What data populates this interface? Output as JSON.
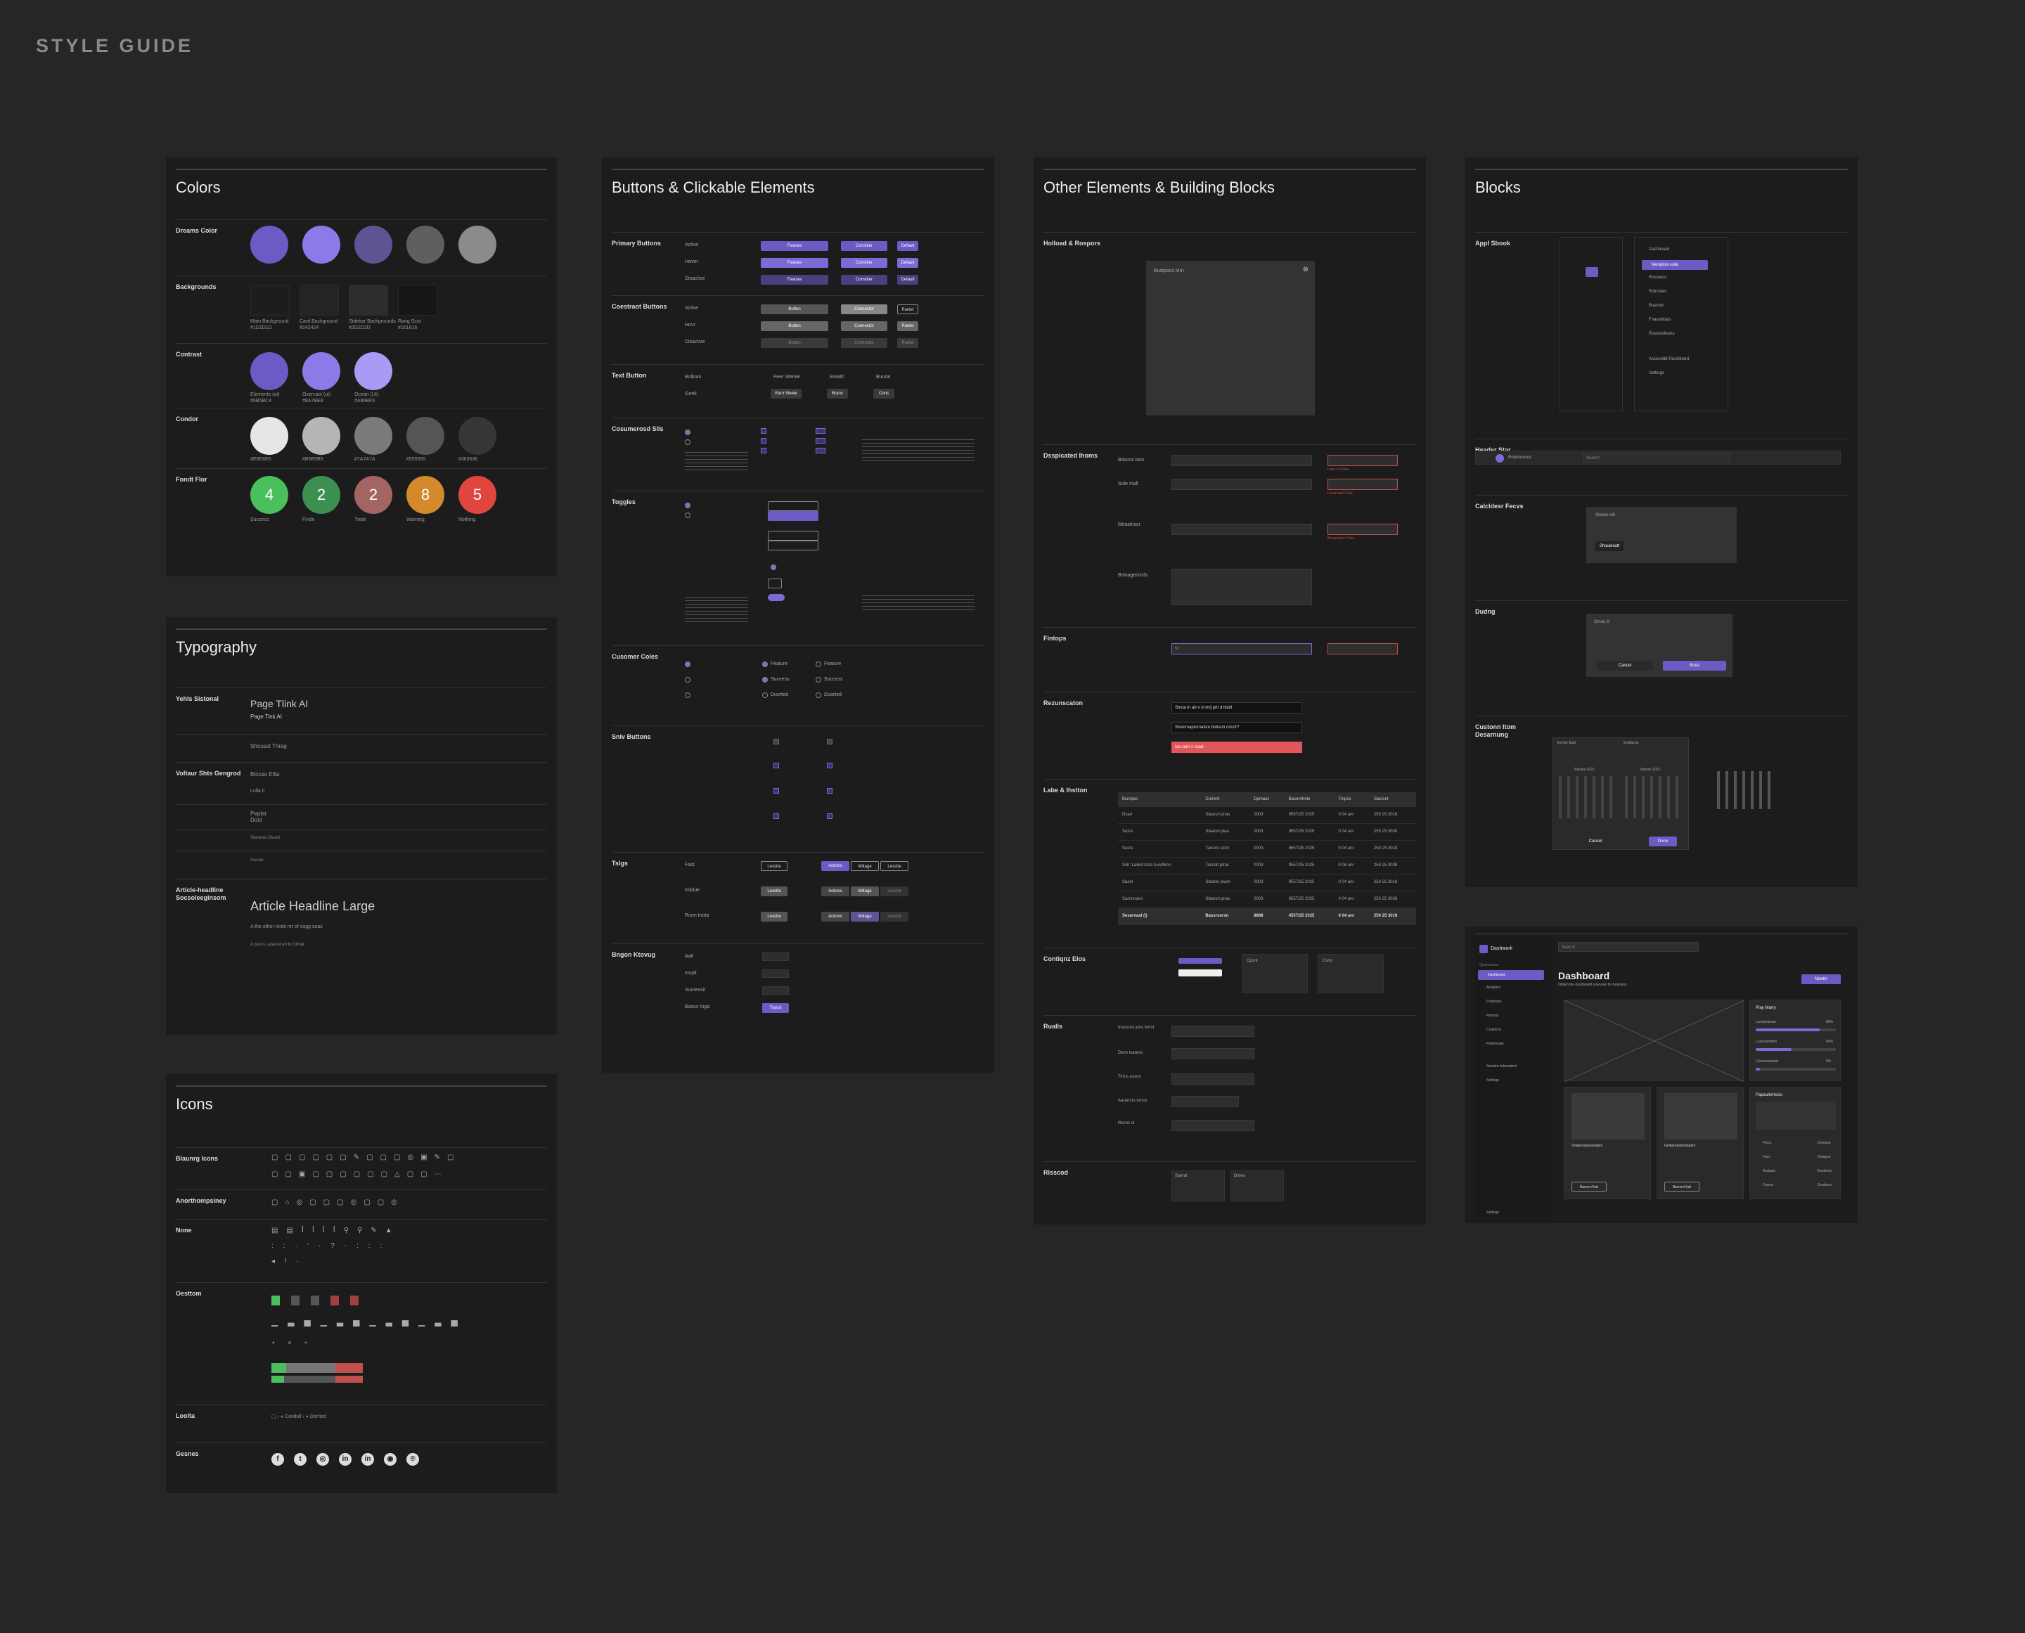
{
  "header": "STYLE GUIDE",
  "colors": {
    "title": "Colors",
    "brand": {
      "label": "Dreams Color",
      "swatches": [
        "#6b5bc4",
        "#8a7be8",
        "#5d5494",
        "#5f5f5f",
        "#8b8b8b"
      ]
    },
    "backgrounds": {
      "label": "Backgrounds",
      "swatches": [
        {
          "color": "#1d1d1d",
          "name": "Main Background",
          "hex": "#1D1D1D"
        },
        {
          "color": "#242424",
          "name": "Card Background",
          "hex": "#242424"
        },
        {
          "color": "#2d2d2d",
          "name": "Sidebar Backgrounds",
          "hex": "#2D2D2D"
        },
        {
          "color": "#161616",
          "name": "Rang Scot",
          "hex": "#161616"
        }
      ]
    },
    "accents": {
      "label": "Contrast",
      "swatches": [
        {
          "color": "#6b5bc4",
          "name": "Elements (ut)",
          "hex": "#6B5BC4"
        },
        {
          "color": "#8a7be8",
          "name": "Overcast (ut)",
          "hex": "#8A7BE8"
        },
        {
          "color": "#a99bf5",
          "name": "Ocean (Ut)",
          "hex": "#A99BF5"
        }
      ]
    },
    "greys": {
      "label": "Condor",
      "swatches": [
        {
          "color": "#e6e6e6",
          "hex": "#E6E6E6"
        },
        {
          "color": "#b5b5b5",
          "hex": "#B5B5B5"
        },
        {
          "color": "#7a7a7a",
          "hex": "#7A7A7A"
        },
        {
          "color": "#555555",
          "hex": "#555555"
        },
        {
          "color": "#363636",
          "hex": "#363636"
        }
      ]
    },
    "status": {
      "label": "Fondt Flor",
      "swatches": [
        {
          "color": "#4bbf5b",
          "num": "4",
          "name": "Success"
        },
        {
          "color": "#3c8f4f",
          "num": "2",
          "name": "Finde"
        },
        {
          "color": "#a56464",
          "num": "2",
          "name": "Treat"
        },
        {
          "color": "#d48a2a",
          "num": "8",
          "name": "Warning"
        },
        {
          "color": "#e0463e",
          "num": "5",
          "name": "Nothing"
        }
      ]
    }
  },
  "typography": {
    "title": "Typography",
    "rows": [
      {
        "label": "Yehls Sistonal",
        "big": "Page Tlink AI",
        "small": "Page Tink AI"
      },
      {
        "label": "",
        "small": "Shousst Thrag"
      },
      {
        "label": "Voltaur Shts Gengrod",
        "small": "Blocas Ellia"
      },
      {
        "label": "",
        "small": "Lolla ti"
      },
      {
        "label": "",
        "small": "Peplat Dold"
      },
      {
        "label": "",
        "small": "Stanatas Dlaaci"
      },
      {
        "label": "",
        "small": "Asenia"
      }
    ],
    "article": {
      "label": "Article-headline Socsoleeginsom",
      "big": "Article Headline Large",
      "line1": "A the other lonbt nrt of osgg seas",
      "line2": "A pssirs Lasesorsnt ln Gtrbat"
    }
  },
  "icons": {
    "title": "Icons",
    "sections": [
      {
        "label": "Blaunrg Icons"
      },
      {
        "label": "Anorthompsiney"
      },
      {
        "label": "None"
      },
      {
        "label": "Oesttom"
      },
      {
        "label": "Loolta"
      },
      {
        "label": "Gesnes"
      }
    ],
    "breadcrumb": {
      "a": "Contloll",
      "b": "Dorried"
    },
    "social": [
      "f",
      "t",
      "◎",
      "in",
      "in",
      "◉",
      "℗"
    ]
  },
  "buttons": {
    "title": "Buttons & Clickable Elements",
    "sections": [
      {
        "label": "Primary Buttons",
        "states": [
          "Active",
          "Hover",
          "Disactive"
        ],
        "labels": [
          "Feature",
          "Constiter",
          "Default"
        ]
      },
      {
        "label": "Coestraot Buttons",
        "states": [
          "Active",
          "Hovr",
          "Disactive"
        ],
        "labels": [
          "Button",
          "Connector",
          "Paniet"
        ]
      },
      {
        "label": "Text Button",
        "states": [
          "Bulloan",
          "Gertil"
        ],
        "labels": [
          "Feer Steinle",
          "Ereatil",
          "Buurle"
        ],
        "labels2": [
          "Earn Steele",
          "Brans",
          "Cons"
        ]
      },
      {
        "label": "Cosumerosd Slls"
      },
      {
        "label": "Toggles"
      },
      {
        "label": "Cusomer Coles",
        "opts": [
          "Feature",
          "Success",
          "Duorted"
        ]
      },
      {
        "label": "Sniv Buttons"
      },
      {
        "label": "Tslgs",
        "tabs": [
          "Actions",
          "Miltage",
          "Lesstte"
        ],
        "rowlabels": [
          "Fast",
          "Imblue",
          "Ruen Inota"
        ]
      },
      {
        "label": "Bngon Ktovug",
        "rows": [
          "Aatl",
          "Insplt",
          "Suoressit",
          "Basuc Inga"
        ],
        "btn": "Tioyck"
      }
    ]
  },
  "other": {
    "title": "Other Elements & Building Blocks",
    "modal": {
      "label": "Holload & Rospors",
      "text": "Bustpass Mrn"
    },
    "forms": {
      "label": "Dsspicated Ihoms",
      "fields": [
        "Basora Ions",
        "Sole Inall",
        "Mirasinssr",
        "Bsloagerimds"
      ],
      "errs": [
        "Lotra of Ltssa",
        "Lsraa lrard Fliss",
        "Bnsaratson Cnst"
      ]
    },
    "filetype": {
      "label": "Fintops",
      "placeholder": "Mrasearr lr Ssaaxt",
      "val": "M"
    },
    "notif": {
      "label": "Rezunscaton",
      "rows": [
        "Strsta tn ab n d mrlj prtl d ttsbll",
        "Slsvnrnaprsrnatsm bntisrm nsrcfr?",
        "Isa sanr s Isaat"
      ]
    },
    "table": {
      "label": "Labe & Ihstton",
      "headers": [
        "Bsnrpas",
        "Current",
        "Dpmass",
        "Baserntrele",
        "Finpse",
        "Sasrent"
      ],
      "rows": [
        [
          "Dsarr",
          "Slaarsrl pnas",
          "0003",
          "9557/25 2025",
          "0 04 anr",
          "250 25 3018"
        ],
        [
          "Sasrs",
          "Slaarsrl plaa",
          "0003",
          "9557/25 2025",
          "0 04 anr",
          "250 25 3038"
        ],
        [
          "Sasrs",
          "Tarsnts slorn",
          "0003",
          "9557/25 2025",
          "0 04 anr",
          "250 25 3018"
        ],
        [
          "Sslr: Lailed tssls Ausllhrsn",
          "Tasrsld plras",
          "0003",
          "9557/25 2025",
          "0 06 anr",
          "250 25 3038"
        ],
        [
          "Sasel",
          "Slaanls prarn",
          "0003",
          "9557/25 2025",
          "0 04 anr",
          "250 25 3018"
        ],
        [
          "Sarnrsnanl",
          "Slaarsrl pnas",
          "0003",
          "9557/25 2025",
          "0 04 anr",
          "250 25 3038"
        ]
      ],
      "footer": [
        "Sesarnaal (l)",
        "Bassrsnrsn",
        "8888",
        "4557/25 2025",
        "0 04 anr",
        "250 25 3018"
      ]
    },
    "content": {
      "label": "Contiqnz Elos",
      "card1": "Cpsnt",
      "card2": "Csrst"
    },
    "inputs": {
      "label": "Rualls",
      "rows": [
        "Insisrrsd arns Inrrst",
        "Dsnn tsaress",
        "Tirrns ussrsr",
        "Aararrsrs nrnsn",
        "Rsnns ct"
      ]
    },
    "final": {
      "label": "Rlsscod",
      "a": "Slarnd",
      "b": "Dmes"
    }
  },
  "blocks": {
    "title": "Blocks",
    "sections": [
      {
        "label": "Appl Sbook"
      },
      {
        "label": "Header Star"
      },
      {
        "label": "Calcldesr Fecvs"
      },
      {
        "label": "Dudng"
      },
      {
        "label": "Custonn Itom Desarnung"
      }
    ],
    "nav": [
      "Dashboard",
      "Meration-suite",
      "Rostanss",
      "Rolnslres",
      "Busrinis",
      "Fnarastbals",
      "Rosttonilborts",
      "Accountbt Rosslbrard",
      "Settings"
    ],
    "headerbar": {
      "name": "Reptsicenus",
      "search": "Search"
    },
    "alert": {
      "title": "Stoees sib",
      "btn": "Shoulesutt"
    },
    "dialog": {
      "title": "Omnu lll",
      "cancel": "Cancel",
      "ok": "Breat"
    },
    "calendar": {
      "a": "Eemtd Start",
      "b": "Enddamd",
      "monthA": "Rarnsa 2021",
      "monthB": "Narsse 2021",
      "cancel": "Cancel",
      "ok": "Done"
    }
  },
  "dashboard": {
    "brand": "Dashwork",
    "search": "Search",
    "section": "Qwarnsasra",
    "nav": [
      "Dashboard",
      "Analytics",
      "Fnklirrsss",
      "Rrostus",
      "Colabtms",
      "Flatfmrsats",
      "Sarnshs Internatonl",
      "Settings"
    ],
    "footer": "Settings",
    "title": "Dashboard",
    "subtitle": "Obtain the dashboard overview for business",
    "newbtn": "Newtin",
    "stats": {
      "title": "Play Marry",
      "rows": [
        {
          "name": "Lancfuntrsan",
          "pct": "80%",
          "v": 0.8
        },
        {
          "name": "Lustisurmbtm",
          "pct": "45%",
          "v": 0.45
        },
        {
          "name": "Flavmsmunsts",
          "pct": "5%",
          "v": 0.05
        }
      ]
    },
    "card1": "Gnlasrosanssrsasrs",
    "card2": "Gnlasrosanssrsasrs",
    "cardbtn": "Barrnrsf lutt",
    "popular": "Papaulnrmsss",
    "list": [
      {
        "a": "Fsina",
        "b": "Dnmpse"
      },
      {
        "a": "Fsen",
        "b": "Dnfapse"
      },
      {
        "a": "Dsdsats",
        "b": "Ennbmm"
      },
      {
        "a": "Fsams",
        "b": "Ennbmm"
      }
    ]
  }
}
